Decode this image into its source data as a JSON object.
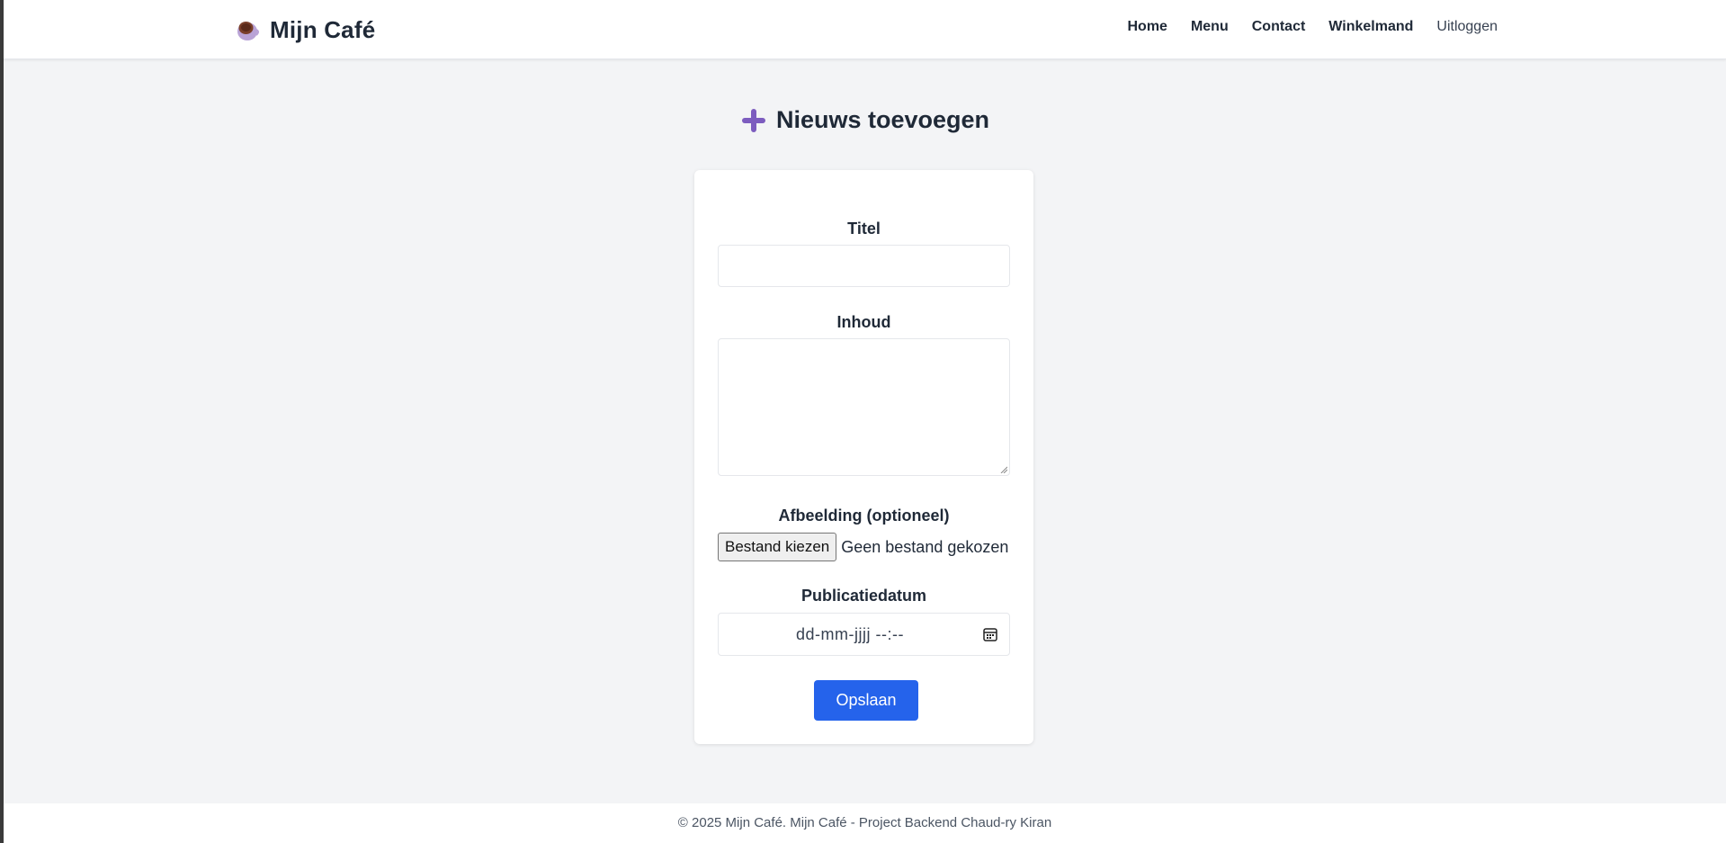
{
  "header": {
    "brand_title": "Mijn Café",
    "brand_icon": "coffee-cup-icon",
    "nav": {
      "home": "Home",
      "menu": "Menu",
      "contact": "Contact",
      "cart": "Winkelmand",
      "logout": "Uitloggen"
    }
  },
  "page": {
    "title": "Nieuws toevoegen",
    "title_icon": "plus-icon",
    "accent_color": "#7c5cbf"
  },
  "form": {
    "title_label": "Titel",
    "title_value": "",
    "content_label": "Inhoud",
    "content_value": "",
    "image_label": "Afbeelding (optioneel)",
    "file_button": "Bestand kiezen",
    "file_status": "Geen bestand gekozen",
    "date_label": "Publicatiedatum",
    "date_placeholder": "dd-mm-jjjj --:--",
    "save_button": "Opslaan",
    "save_color": "#2563eb"
  },
  "footer": {
    "text": "© 2025 Mijn Café. Mijn Café - Project Backend Chaud-ry Kiran"
  }
}
